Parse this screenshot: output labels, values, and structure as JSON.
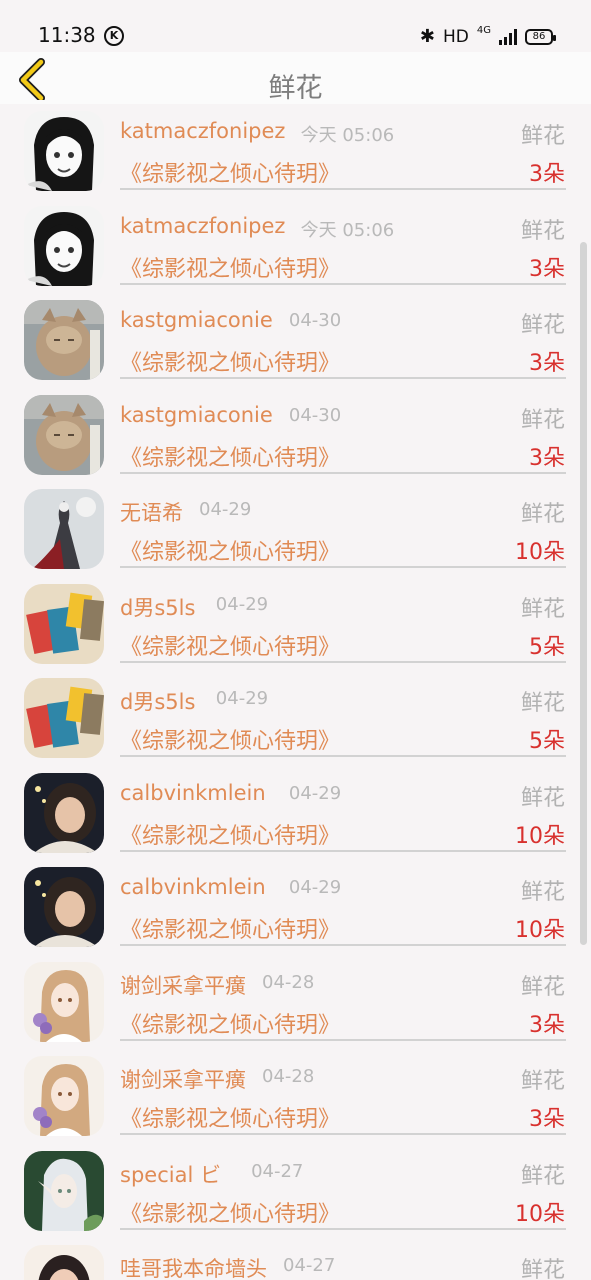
{
  "status_bar": {
    "time": "11:38",
    "k_badge": "K",
    "hd": "HD",
    "network": "4G",
    "battery": "86"
  },
  "nav": {
    "title": "鲜花"
  },
  "items": [
    {
      "name": "katmaczfonipez",
      "time": "今天 05:06",
      "type": "鲜花",
      "book": "《综影视之倾心待玥》",
      "count": "3朵"
    },
    {
      "name": "katmaczfonipez",
      "time": "今天 05:06",
      "type": "鲜花",
      "book": "《综影视之倾心待玥》",
      "count": "3朵"
    },
    {
      "name": "kastgmiaconie",
      "time": "04-30",
      "type": "鲜花",
      "book": "《综影视之倾心待玥》",
      "count": "3朵"
    },
    {
      "name": "kastgmiaconie",
      "time": "04-30",
      "type": "鲜花",
      "book": "《综影视之倾心待玥》",
      "count": "3朵"
    },
    {
      "name": "无语希",
      "time": "04-29",
      "type": "鲜花",
      "book": "《综影视之倾心待玥》",
      "count": "10朵"
    },
    {
      "name": "d男s5ls",
      "time": "04-29",
      "type": "鲜花",
      "book": "《综影视之倾心待玥》",
      "count": "5朵"
    },
    {
      "name": "d男s5ls",
      "time": "04-29",
      "type": "鲜花",
      "book": "《综影视之倾心待玥》",
      "count": "5朵"
    },
    {
      "name": "calbvinkmlein",
      "time": "04-29",
      "type": "鲜花",
      "book": "《综影视之倾心待玥》",
      "count": "10朵"
    },
    {
      "name": "calbvinkmlein",
      "time": "04-29",
      "type": "鲜花",
      "book": "《综影视之倾心待玥》",
      "count": "10朵"
    },
    {
      "name": "谢剑采拿平癀",
      "time": "04-28",
      "type": "鲜花",
      "book": "《综影视之倾心待玥》",
      "count": "3朵"
    },
    {
      "name": "谢剑采拿平癀",
      "time": "04-28",
      "type": "鲜花",
      "book": "《综影视之倾心待玥》",
      "count": "3朵"
    },
    {
      "name": "special ビ",
      "time": "04-27",
      "type": "鲜花",
      "book": "《综影视之倾心待玥》",
      "count": "10朵"
    },
    {
      "name": "哇哥我本命墙头",
      "time": "04-27",
      "type": "鲜花",
      "book": "",
      "count": ""
    }
  ],
  "colors": {
    "accent": "#e08b55",
    "count": "#d8312e",
    "muted": "#b2b2b2",
    "back_arrow": "#f2ca18"
  }
}
